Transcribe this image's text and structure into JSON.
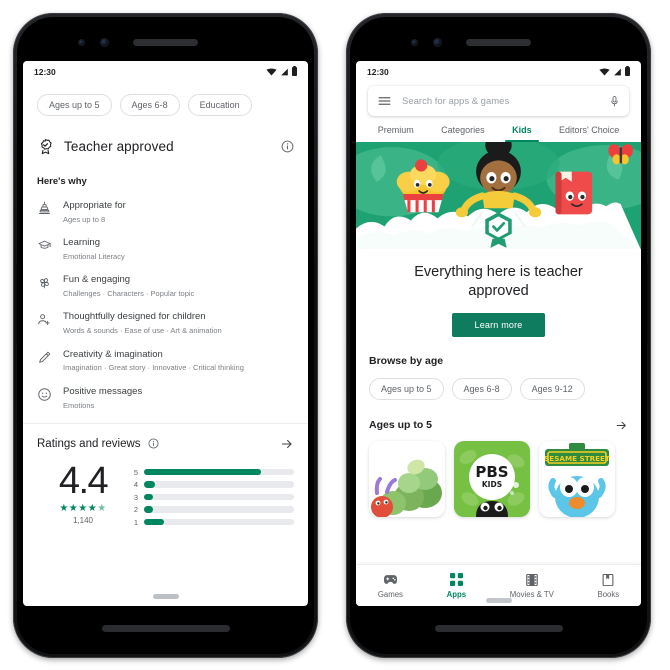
{
  "colors": {
    "brand_green": "#01875f",
    "button_green": "#0f7b5f",
    "banner_green": "#1ea273",
    "banner_mint": "#6fc9a4",
    "text_primary": "#202124",
    "text_secondary": "#5f6368",
    "text_tertiary": "#7b7f84",
    "chip_border": "#dcdfe2",
    "bar_track": "#e8eaed"
  },
  "left_phone": {
    "status": {
      "time": "12:30",
      "wifi": "wifi-icon",
      "signal": "signal-icon",
      "battery": "battery-icon"
    },
    "filter_chips": [
      {
        "label": "Ages up to 5"
      },
      {
        "label": "Ages 6-8"
      },
      {
        "label": "Education"
      }
    ],
    "teacher_approved": {
      "icon": "award-badge-icon",
      "title": "Teacher approved",
      "info_icon": "info-icon"
    },
    "heres_why_label": "Here's why",
    "why_items": [
      {
        "icon": "cake-icon",
        "title": "Appropriate for",
        "subtitle": "Ages up to 8"
      },
      {
        "icon": "graduation-cap-icon",
        "title": "Learning",
        "subtitle": "Emotional Literacy"
      },
      {
        "icon": "pinwheel-icon",
        "title": "Fun & engaging",
        "subtitle": "Challenges  ·  Characters  ·  Popular topic"
      },
      {
        "icon": "person-add-icon",
        "title": "Thoughtfully designed for children",
        "subtitle": "Words & sounds  ·  Ease of use  ·  Art & animation"
      },
      {
        "icon": "pencil-icon",
        "title": "Creativity & imagination",
        "subtitle": "Imagination  ·  Great story  ·  Innovative  ·  Critical thinking"
      },
      {
        "icon": "smiley-icon",
        "title": "Positive messages",
        "subtitle": "Emotions"
      }
    ],
    "ratings": {
      "title": "Ratings and reviews",
      "info_icon": "info-icon",
      "arrow_icon": "arrow-right-icon",
      "score": "4.4",
      "stars": "★★★★",
      "half_star": "★",
      "count": "1,140"
    },
    "home_indicator": "home-indicator"
  },
  "right_phone": {
    "status": {
      "time": "12:30",
      "wifi": "wifi-icon",
      "signal": "signal-icon",
      "battery": "battery-icon"
    },
    "search": {
      "menu_icon": "hamburger-menu-icon",
      "placeholder": "Search for apps & games",
      "mic_icon": "microphone-icon"
    },
    "tabs": [
      {
        "label": "Premium",
        "active": false
      },
      {
        "label": "Categories",
        "active": false
      },
      {
        "label": "Kids",
        "active": true
      },
      {
        "label": "Editors' Choice",
        "active": false
      }
    ],
    "banner": {
      "illustration": "teacher-approved-hero-illustration",
      "elements": [
        "cupcake-character",
        "teacher-character",
        "book-character",
        "butterfly",
        "verified-badge"
      ]
    },
    "hero_title": "Everything here is teacher approved",
    "learn_more_label": "Learn more",
    "browse_by_age_label": "Browse by age",
    "age_chips": [
      {
        "label": "Ages up to 5"
      },
      {
        "label": "Ages 6-8"
      },
      {
        "label": "Ages 9-12"
      }
    ],
    "ages_section": {
      "title": "Ages up to 5",
      "arrow_icon": "arrow-right-icon",
      "tiles": [
        {
          "name": "caterpillar-app-tile",
          "label": ""
        },
        {
          "name": "pbs-kids-app-tile",
          "label": "PBS",
          "sublabel": "KIDS"
        },
        {
          "name": "sesame-street-app-tile",
          "label": "SESAME STREET"
        }
      ]
    },
    "bottom_nav": [
      {
        "icon": "gamepad-icon",
        "label": "Games",
        "active": false
      },
      {
        "icon": "grid-apps-icon",
        "label": "Apps",
        "active": true
      },
      {
        "icon": "film-icon",
        "label": "Movies & TV",
        "active": false
      },
      {
        "icon": "book-icon",
        "label": "Books",
        "active": false
      }
    ]
  }
}
